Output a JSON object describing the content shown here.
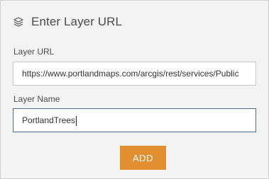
{
  "header": {
    "icon": "layers-icon",
    "title": "Enter Layer URL"
  },
  "form": {
    "url_label": "Layer URL",
    "url_value": "https://www.portlandmaps.com/arcgis/rest/services/Public",
    "name_label": "Layer Name",
    "name_value": "PortlandTrees"
  },
  "actions": {
    "add_label": "ADD"
  },
  "colors": {
    "accent": "#e28f32",
    "focus_border": "#4b6a8c",
    "background": "#f3f3f3"
  }
}
